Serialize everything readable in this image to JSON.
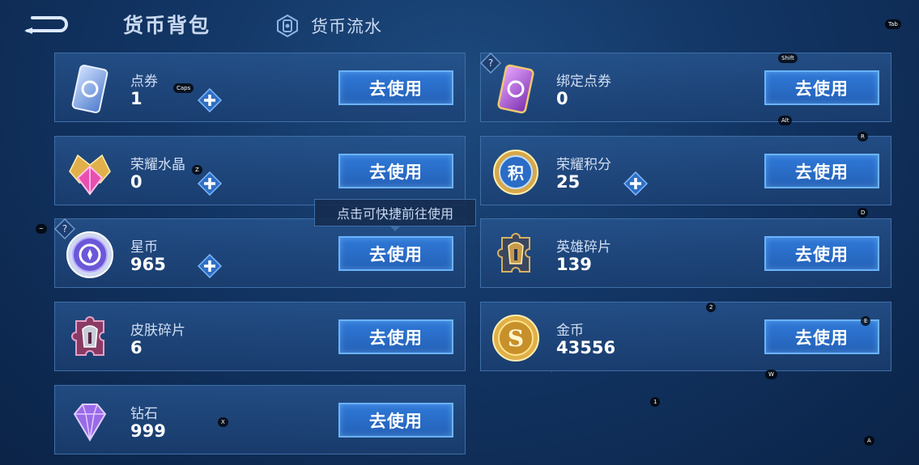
{
  "header": {
    "title": "货币背包",
    "flow_label": "货币流水"
  },
  "use_label": "去使用",
  "tooltip": "点击可快捷前往使用",
  "currencies": [
    {
      "name": "点券",
      "value": "1",
      "icon": "ticket-icon",
      "color": "#6f9be8"
    },
    {
      "name": "绑定点券",
      "value": "0",
      "icon": "bound-ticket-icon",
      "color": "#b05ad6"
    },
    {
      "name": "荣耀水晶",
      "value": "0",
      "icon": "glory-crystal-icon",
      "color": "#e84fb0"
    },
    {
      "name": "荣耀积分",
      "value": "25",
      "icon": "glory-points-icon",
      "color": "#2b6cc6"
    },
    {
      "name": "星币",
      "value": "965",
      "icon": "star-coin-icon",
      "color": "#7a68e8"
    },
    {
      "name": "英雄碎片",
      "value": "139",
      "icon": "hero-fragment-icon",
      "color": "#c79a4a"
    },
    {
      "name": "皮肤碎片",
      "value": "6",
      "icon": "skin-fragment-icon",
      "color": "#b04a7a"
    },
    {
      "name": "金币",
      "value": "43556",
      "icon": "gold-coin-icon",
      "color": "#e0b04a"
    },
    {
      "name": "钻石",
      "value": "999",
      "icon": "diamond-icon",
      "color": "#9a6ae8"
    }
  ],
  "key_hints": [
    "Tab",
    "Shift",
    "Caps",
    "Alt",
    "R",
    "Z",
    "D",
    "~",
    "2",
    "E",
    "W",
    "1",
    "X",
    "A"
  ]
}
